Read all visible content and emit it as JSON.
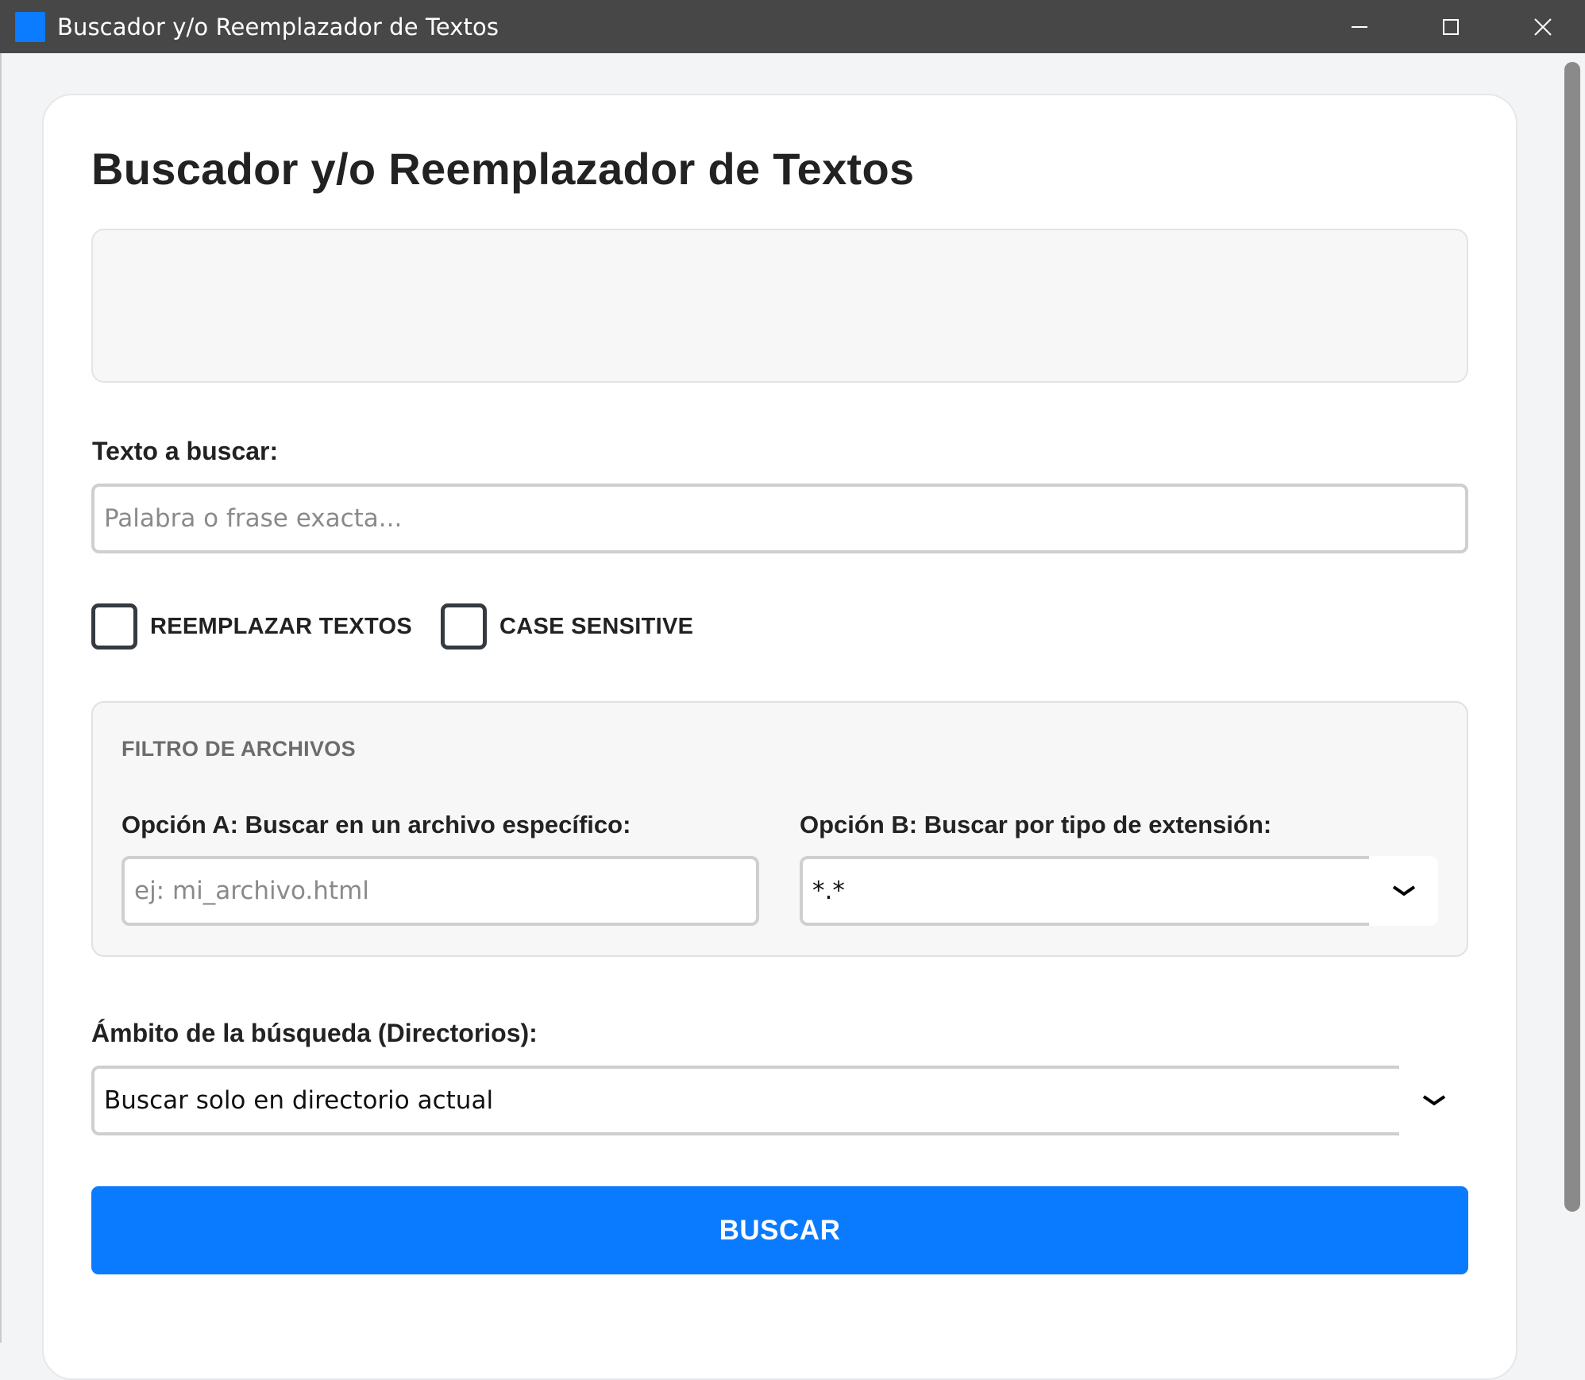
{
  "window": {
    "title": "Buscador y/o Reemplazador de Textos"
  },
  "page": {
    "title": "Buscador y/o Reemplazador de Textos"
  },
  "search": {
    "label": "Texto a buscar:",
    "value": "",
    "placeholder": "Palabra o frase exacta..."
  },
  "options": {
    "replace_label": "REEMPLAZAR TEXTOS",
    "replace_checked": false,
    "case_label": "CASE SENSITIVE",
    "case_checked": false
  },
  "file_filter": {
    "legend": "FILTRO DE ARCHIVOS",
    "option_a_label": "Opción A: Buscar en un archivo específico:",
    "option_a_value": "",
    "option_a_placeholder": "ej: mi_archivo.html",
    "option_b_label": "Opción B: Buscar por tipo de extensión:",
    "option_b_selected": "*.*"
  },
  "scope": {
    "label": "Ámbito de la búsqueda (Directorios):",
    "selected": "Buscar solo en directorio actual"
  },
  "actions": {
    "search_button": "BUSCAR"
  },
  "colors": {
    "titlebar": "#474747",
    "accent": "#0a7bff",
    "app_icon": "#0b7bff"
  }
}
